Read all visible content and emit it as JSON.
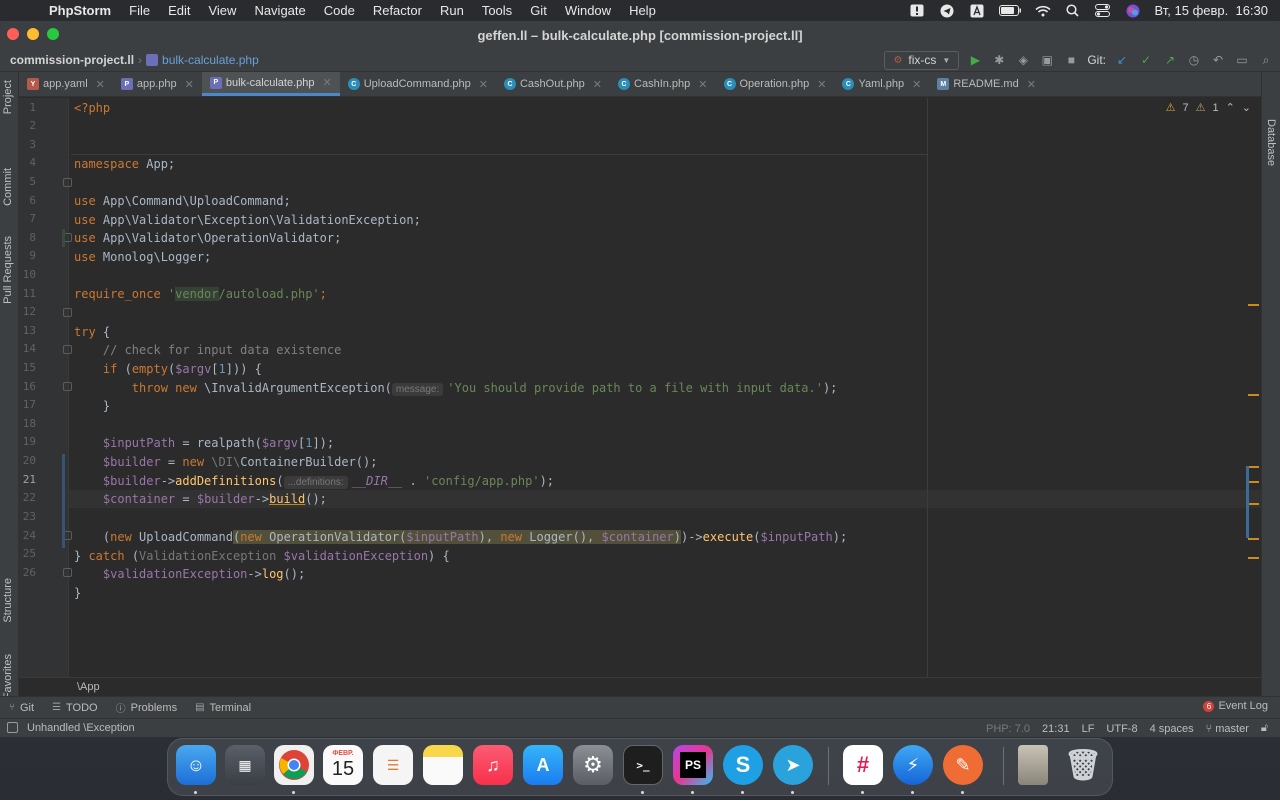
{
  "menubar": {
    "app": "PhpStorm",
    "items": [
      "File",
      "Edit",
      "View",
      "Navigate",
      "Code",
      "Refactor",
      "Run",
      "Tools",
      "Git",
      "Window",
      "Help"
    ],
    "datetime": "Вт, 15 февр.  16:30",
    "icons": [
      "exclamation-icon",
      "telegram-status-icon",
      "input-source-icon",
      "battery-icon",
      "wifi-icon",
      "spotlight-icon",
      "control-center-icon",
      "siri-icon"
    ]
  },
  "window": {
    "title": "geffen.ll – bulk-calculate.php [commission-project.ll]"
  },
  "navbar": {
    "project": "commission-project.ll",
    "file": "bulk-calculate.php",
    "branch_config": "fix-cs",
    "git_label": "Git:"
  },
  "tool_strip": {
    "left": [
      "Project",
      "Commit",
      "Pull Requests",
      "Structure",
      "Favorites"
    ],
    "right": [
      "Database"
    ]
  },
  "tabs": [
    {
      "label": "app.yaml",
      "icon": "yaml",
      "active": false
    },
    {
      "label": "app.php",
      "icon": "php",
      "active": false
    },
    {
      "label": "bulk-calculate.php",
      "icon": "php",
      "active": true
    },
    {
      "label": "UploadCommand.php",
      "icon": "class",
      "active": false
    },
    {
      "label": "CashOut.php",
      "icon": "class",
      "active": false
    },
    {
      "label": "CashIn.php",
      "icon": "class",
      "active": false
    },
    {
      "label": "Operation.php",
      "icon": "class",
      "active": false
    },
    {
      "label": "Yaml.php",
      "icon": "class",
      "active": false
    },
    {
      "label": "README.md",
      "icon": "md",
      "active": false
    }
  ],
  "inspections": {
    "warnings": "7",
    "weak_warnings": "1"
  },
  "code": {
    "line_numbers": [
      "1",
      "2",
      "3",
      "4",
      "5",
      "6",
      "7",
      "8",
      "9",
      "10",
      "11",
      "12",
      "13",
      "14",
      "15",
      "16",
      "17",
      "18",
      "19",
      "20",
      "21",
      "22",
      "23",
      "24",
      "25",
      "26"
    ],
    "current_line": "21",
    "l1": "<?php",
    "l3_kw": "namespace",
    "l3_ns": " App;",
    "use_kw": "use",
    "l5": " App\\Command\\UploadCommand;",
    "l6": " App\\Validator\\Exception\\ValidationException;",
    "l7": " App\\Validator\\OperationValidator;",
    "l8": " Monolog\\Logger;",
    "l10_kw": "require_once",
    "l10_q": " '",
    "l10_vendor": "vendor",
    "l10_rest": "/autoload.php'",
    "l10_end": ";",
    "l12_kw": "try",
    "l12_rest": " {",
    "l13": "    // check for input data existence",
    "l14_if": "    if",
    "l14_a": " (",
    "l14_fn": "empty",
    "l14_b": "(",
    "l14_var": "$argv",
    "l14_c": "[",
    "l14_num": "1",
    "l14_d": "])) {",
    "l15_a": "        throw",
    "l15_b": " new",
    "l15_c": " \\InvalidArgumentException(",
    "l15_hint": "message:",
    "l15_str": "'You should provide path to a file with input data.'",
    "l15_end": ");",
    "l16": "    }",
    "l18_var": "    $inputPath",
    "l18_a": " = realpath(",
    "l18_var2": "$argv",
    "l18_b": "[",
    "l18_num": "1",
    "l18_c": "]);",
    "l19_var": "    $builder",
    "l19_a": " = ",
    "l19_kw": "new",
    "l19_b": " \\DI\\",
    "l19_c": "ContainerBuilder();",
    "l20_var": "    $builder",
    "l20_a": "->",
    "l20_fn": "addDefinitions",
    "l20_b": "(",
    "l20_hint": "...definitions:",
    "l20_const": "__DIR__",
    "l20_c": " . ",
    "l20_str": "'config/app.php'",
    "l20_d": ");",
    "l21_var": "    $container",
    "l21_a": " = ",
    "l21_var2": "$builder",
    "l21_b": "->",
    "l21_fn": "build",
    "l21_c": "();",
    "l23_a": "    (",
    "l23_kw": "new",
    "l23_b": " UploadCommand",
    "l23_c": "(",
    "l23_kw2": "new",
    "l23_d": " OperationValidator(",
    "l23_var": "$inputPath",
    "l23_e": "), ",
    "l23_kw3": "new",
    "l23_f": " Logger(), ",
    "l23_var2": "$container",
    "l23_g": ")",
    "l23_h": ")->",
    "l23_fn": "execute",
    "l23_i": "(",
    "l23_var3": "$inputPath",
    "l23_j": ");",
    "l24_a": "}",
    "l24_kw": " catch",
    "l24_b": " (",
    "l24_type": "ValidationException",
    "l24_var": " $validationException",
    "l24_c": ") {",
    "l25_var": "    $validationException",
    "l25_a": "->",
    "l25_fn": "log",
    "l25_b": "();",
    "l26": "}"
  },
  "breadcrumb_bottom": "\\App",
  "tool_windows": {
    "items": [
      {
        "label": "Git",
        "icon": "git-icon"
      },
      {
        "label": "TODO",
        "icon": "todo-icon"
      },
      {
        "label": "Problems",
        "icon": "problems-icon"
      },
      {
        "label": "Terminal",
        "icon": "terminal-icon"
      }
    ],
    "event_log": "Event Log",
    "event_count": "6"
  },
  "status": {
    "message": "Unhandled \\Exception",
    "php_level": "PHP: 7.0",
    "position": "21:31",
    "line_sep": "LF",
    "encoding": "UTF-8",
    "indent": "4 spaces",
    "branch": "master"
  },
  "dock": {
    "apps": [
      "Finder",
      "Launchpad",
      "Chrome",
      "Calendar",
      "Reminders",
      "Notes",
      "Music",
      "App Store",
      "System Preferences",
      "Terminal",
      "PhpStorm",
      "Skype",
      "Telegram",
      "Slack",
      "Spark",
      "Postman",
      "Downloads",
      "Trash"
    ],
    "calendar_month": "ФЕВР.",
    "calendar_day": "15"
  }
}
